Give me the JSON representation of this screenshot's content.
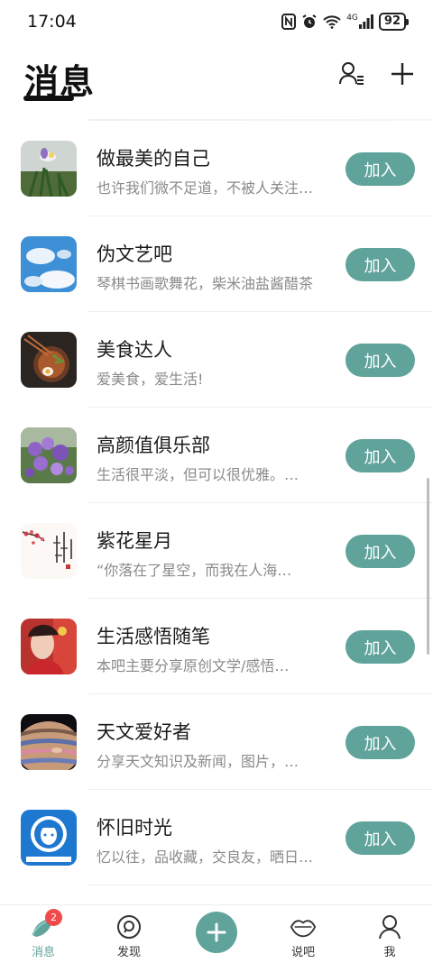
{
  "status_bar": {
    "time": "17:04",
    "network": "4G",
    "battery": "92"
  },
  "header": {
    "title": "消息"
  },
  "colors": {
    "accent": "#5fa39a",
    "badge": "#ef4b4b"
  },
  "groups": [
    {
      "title": "做最美的自己",
      "desc": "也许我们微不足道，不被人关注…",
      "join": "加入",
      "avatar": "iris-flower"
    },
    {
      "title": "伪文艺吧",
      "desc": "琴棋书画歌舞花，柴米油盐酱醋茶",
      "join": "加入",
      "avatar": "blue-sky"
    },
    {
      "title": "美食达人",
      "desc": "爱美食，爱生活!",
      "join": "加入",
      "avatar": "food-bowl"
    },
    {
      "title": "高颜值俱乐部",
      "desc": "生活很平淡，但可以很优雅。…",
      "join": "加入",
      "avatar": "purple-flowers"
    },
    {
      "title": "紫花星月",
      "desc": "“你落在了星空，而我在人海…",
      "join": "加入",
      "avatar": "plum-blossom-calligraphy"
    },
    {
      "title": "生活感悟随笔",
      "desc": "本吧主要分享原创文学/感悟…",
      "join": "加入",
      "avatar": "woman-portrait"
    },
    {
      "title": "天文爱好者",
      "desc": "分享天文知识及新闻，图片，…",
      "join": "加入",
      "avatar": "planet-jupiter"
    },
    {
      "title": "怀旧时光",
      "desc": "忆以往，品收藏，交良友，晒日…",
      "join": "加入",
      "avatar": "retro-poster"
    }
  ],
  "tabs": [
    {
      "label": "消息",
      "icon": "message-icon",
      "badge": "2",
      "active": true
    },
    {
      "label": "发现",
      "icon": "discover-icon"
    },
    {
      "label": "",
      "icon": "plus-icon"
    },
    {
      "label": "说吧",
      "icon": "lips-icon"
    },
    {
      "label": "我",
      "icon": "profile-icon"
    }
  ]
}
